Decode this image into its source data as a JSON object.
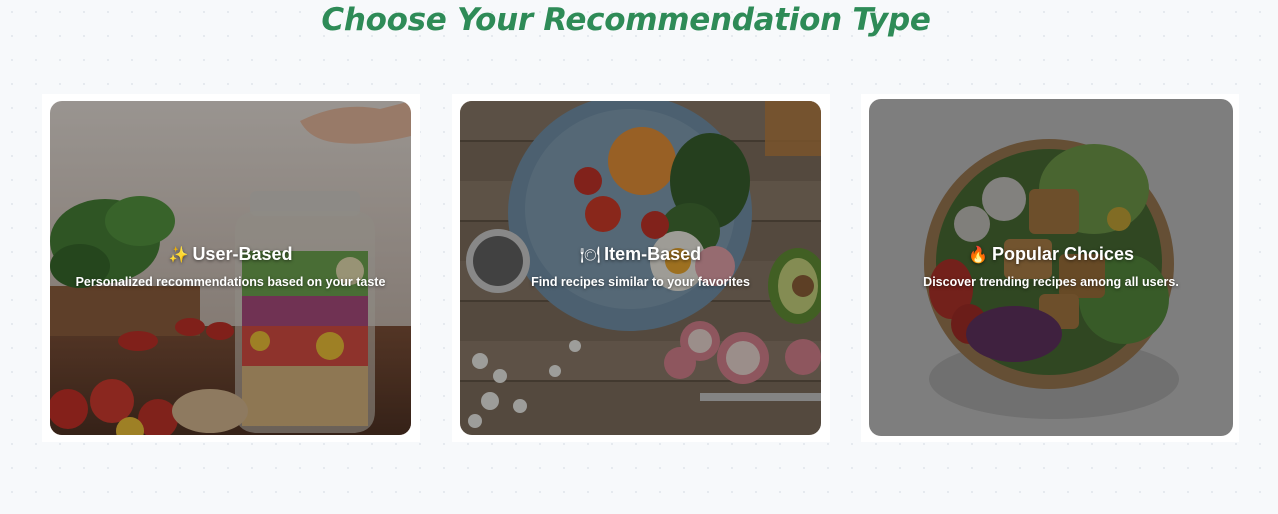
{
  "header": {
    "title": "Choose Your Recommendation Type"
  },
  "cards": [
    {
      "icon": "sparkles-icon",
      "emoji": "✨",
      "title": "User-Based",
      "description": "Personalized recommendations based on your taste"
    },
    {
      "icon": "plate-cutlery-icon",
      "emoji": "🍽",
      "title": "Item-Based",
      "description": "Find recipes similar to your favorites"
    },
    {
      "icon": "fire-icon",
      "emoji": "🔥",
      "title": "Popular Choices",
      "description": "Discover trending recipes among all users."
    }
  ],
  "colors": {
    "title": "#2e8b57",
    "background": "#f7f9fb",
    "card_text": "#ffffff"
  }
}
